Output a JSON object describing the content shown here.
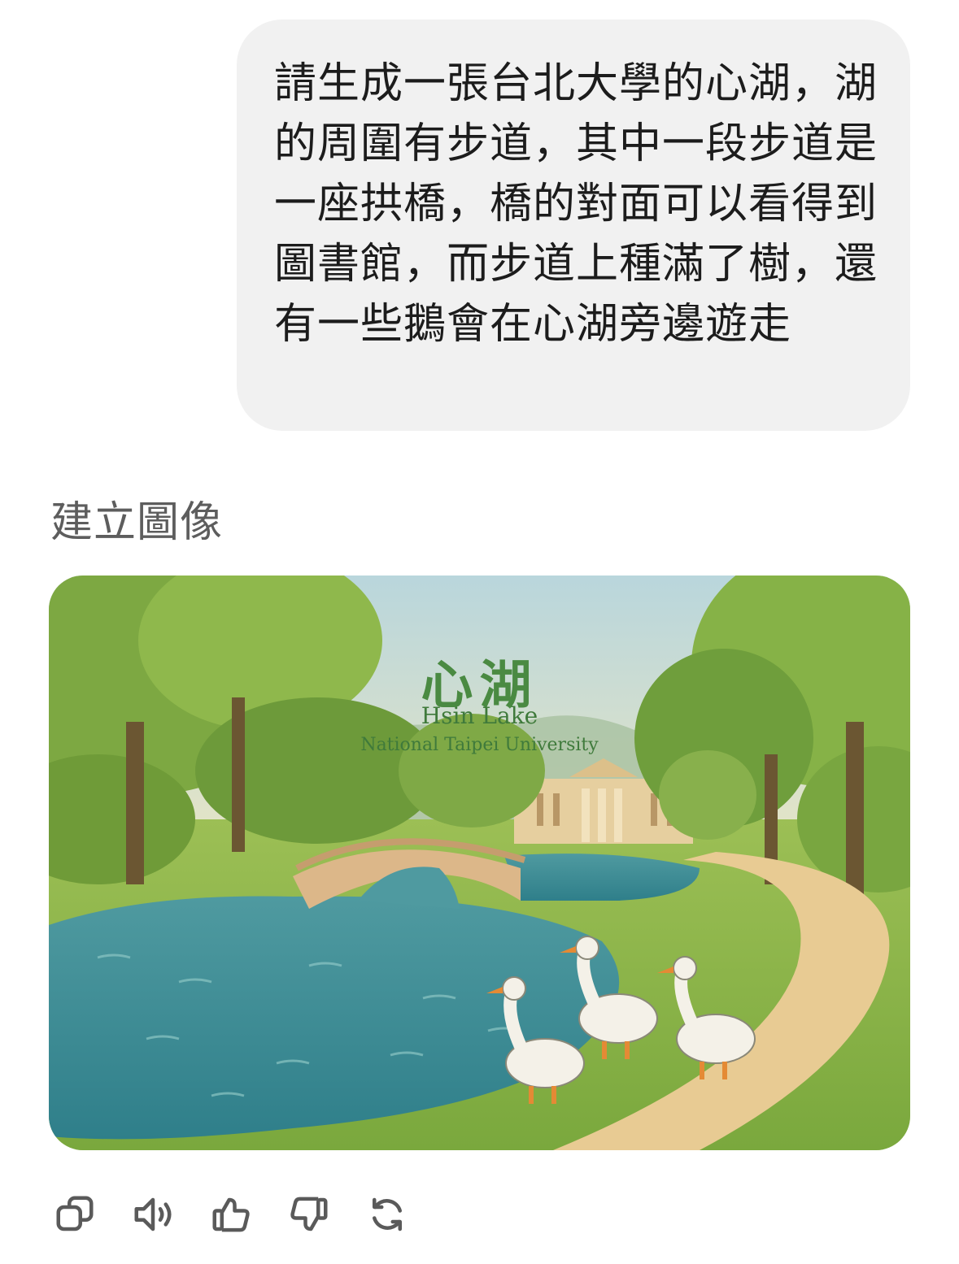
{
  "conversation": {
    "user_message": "請生成一張台北大學的心湖，湖的周圍有步道，其中一段步道是一座拱橋，橋的對面可以看得到圖書館，而步道上種滿了樹，還有一些鵝會在心湖旁邊遊走",
    "assistant_status": "建立圖像",
    "generated_image": {
      "title_zh": "心湖",
      "title_en": "Hsin Lake",
      "subtitle": "National Taipei University"
    }
  },
  "actions": {
    "icons": [
      "copy-icon",
      "read-aloud-icon",
      "thumbs-up-icon",
      "thumbs-down-icon",
      "regenerate-icon"
    ]
  },
  "colors": {
    "bubble_bg": "#f1f1f1",
    "status_text": "#5d5d5d",
    "icon_stroke": "#5a5a5a",
    "caption_green": "#3f7a3b"
  }
}
